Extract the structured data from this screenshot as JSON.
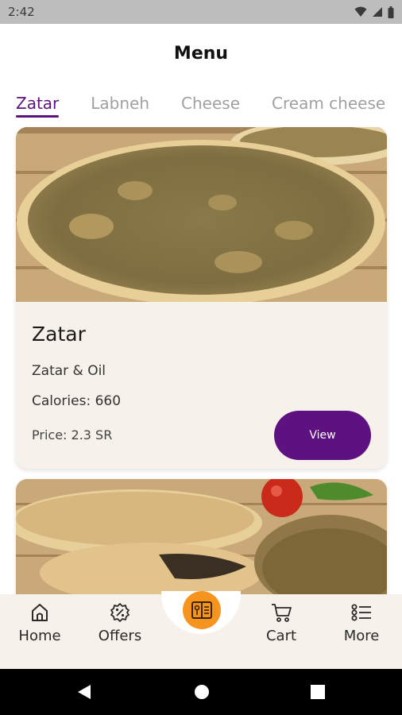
{
  "status_bar": {
    "time": "2:42"
  },
  "header": {
    "title": "Menu"
  },
  "tabs": [
    {
      "label": "Zatar",
      "active": true
    },
    {
      "label": "Labneh",
      "active": false
    },
    {
      "label": "Cheese",
      "active": false
    },
    {
      "label": "Cream cheese",
      "active": false
    }
  ],
  "items": [
    {
      "name": "Zatar",
      "description": "Zatar & Oil",
      "calories_label": "Calories:  660",
      "price_label": "Price:  2.3 SR",
      "view_label": "View"
    }
  ],
  "bottom_nav": {
    "home": "Home",
    "offers": "Offers",
    "menu_icon": "menu-book-icon",
    "cart": "Cart",
    "more": "More"
  },
  "colors": {
    "accent": "#5e1180",
    "fab": "#f7941d",
    "card_bg": "#f6f1ea"
  }
}
